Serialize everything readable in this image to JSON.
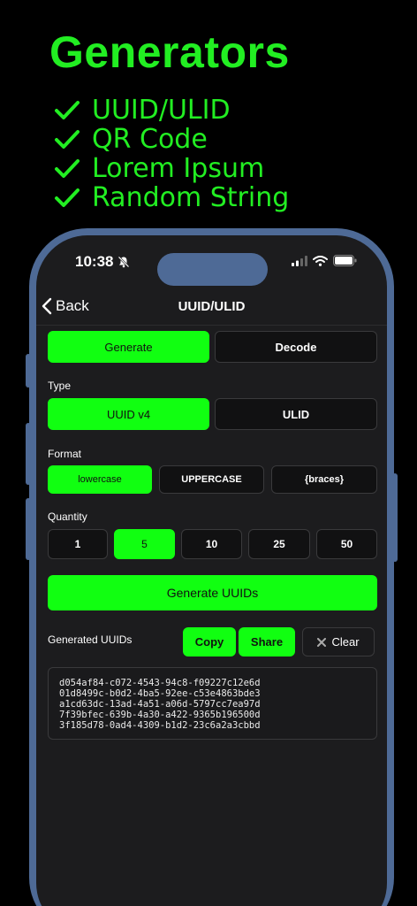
{
  "promo": {
    "title": "Generators",
    "features": [
      "UUID/ULID",
      "QR Code",
      "Lorem Ipsum",
      "Random String"
    ],
    "accent": "#22ee22"
  },
  "status": {
    "time": "10:38"
  },
  "nav": {
    "back_label": "Back",
    "title": "UUID/ULID"
  },
  "mode": {
    "generate": "Generate",
    "decode": "Decode",
    "selected": "Generate"
  },
  "type": {
    "label": "Type",
    "uuid_v4": "UUID v4",
    "ulid": "ULID",
    "selected": "UUID v4"
  },
  "format": {
    "label": "Format",
    "lowercase": "lowercase",
    "uppercase": "UPPERCASE",
    "braces": "{braces}",
    "selected": "lowercase"
  },
  "quantity": {
    "label": "Quantity",
    "options": [
      "1",
      "5",
      "10",
      "25",
      "50"
    ],
    "selected": "5"
  },
  "generate_button": "Generate UUIDs",
  "results": {
    "label": "Generated UUIDs",
    "copy": "Copy",
    "share": "Share",
    "clear": "Clear",
    "uuids": [
      "d054af84-c072-4543-94c8-f09227c12e6d",
      "01d8499c-b0d2-4ba5-92ee-c53e4863bde3",
      "a1cd63dc-13ad-4a51-a06d-5797cc7ea97d",
      "7f39bfec-639b-4a30-a422-9365b196500d",
      "3f185d78-0ad4-4309-b1d2-23c6a2a3cbbd"
    ]
  },
  "colors": {
    "green": "#11ff11",
    "background": "#1c1c1e",
    "phone_frame": "#4e6a96"
  }
}
